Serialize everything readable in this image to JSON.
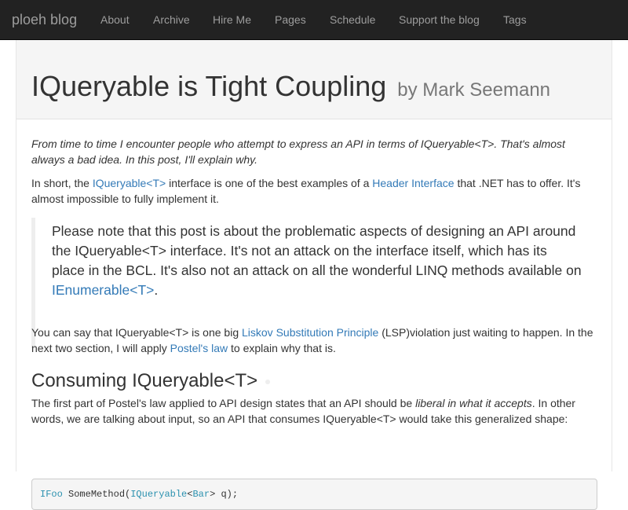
{
  "nav": {
    "brand": "ploeh blog",
    "items": [
      "About",
      "Archive",
      "Hire Me",
      "Pages",
      "Schedule",
      "Support the blog",
      "Tags"
    ]
  },
  "post": {
    "title": "IQueryable is Tight Coupling",
    "byline": "by Mark Seemann",
    "lead": "From time to time I encounter people who attempt to express an API in terms of IQueryable<T>. That's almost always a bad idea. In this post, I'll explain why.",
    "p2": {
      "t1": "In short, the ",
      "link1": "IQueryable<T>",
      "t2": " interface is one of the best examples of a ",
      "link2": "Header Interface",
      "t3": " that .NET has to offer. It's almost impossible to fully implement it."
    },
    "quote": {
      "text": "Please note that this post is about the problematic aspects of designing an API around the IQueryable<T> interface. It's not an attack on the interface itself, which has its place in the BCL. It's also not an attack on all the wonderful LINQ methods available on ",
      "link": "IEnumerable<T>",
      "end": "."
    },
    "p3": {
      "t1": "You can say that IQueryable<T> is one big ",
      "link1": "Liskov Substitution Principle",
      "t2": " (LSP)violation just waiting to happen. In the next two section, I will apply ",
      "link2": "Postel's law",
      "t3": " to explain why that is."
    },
    "heading": "Consuming IQueryable<T>",
    "p4": {
      "t1": "The first part of Postel's law applied to API design states that an API should be ",
      "em": "liberal in what it accepts",
      "t2": ". In other words, we are talking about input, so an API that consumes IQueryable<T> would take this generalized shape:"
    },
    "code": {
      "type1": "IFoo",
      "method": " SomeMethod(",
      "type2": "IQueryable",
      "lt": "<",
      "type3": "Bar",
      "rest": "> q);"
    }
  },
  "colors": {
    "navbar": "#222222",
    "link": "#337ab7",
    "code_type": "#2b91af"
  }
}
